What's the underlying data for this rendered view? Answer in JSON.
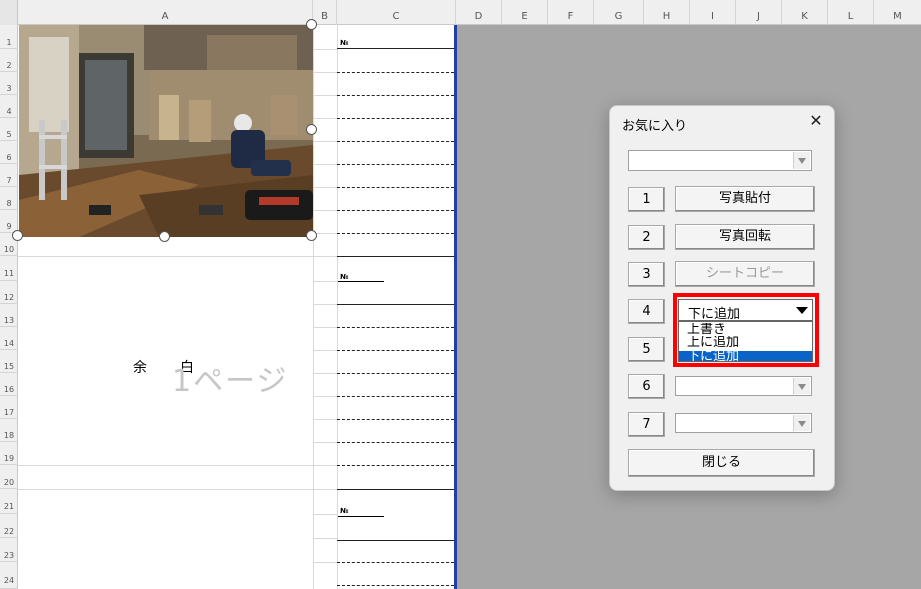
{
  "sheet": {
    "columns": [
      "A",
      "B",
      "C",
      "D",
      "E",
      "F",
      "G",
      "H",
      "I",
      "J",
      "K",
      "L",
      "M"
    ],
    "rows": [
      "1",
      "2",
      "3",
      "4",
      "5",
      "6",
      "7",
      "8",
      "9",
      "10",
      "11",
      "12",
      "13",
      "14",
      "15",
      "16",
      "17",
      "18",
      "19",
      "20",
      "21",
      "22",
      "23",
      "24"
    ],
    "no_label": "№",
    "margin_label_1": "余",
    "margin_label_2": "白",
    "page_watermark": "1ページ"
  },
  "dialog": {
    "title": "お気に入り",
    "close_glyph": "✕",
    "top_combo_value": "",
    "buttons": [
      {
        "num": "1",
        "label": "写真貼付",
        "enabled": true
      },
      {
        "num": "2",
        "label": "写真回転",
        "enabled": true
      },
      {
        "num": "3",
        "label": "シートコピー",
        "enabled": false
      },
      {
        "num": "4",
        "label": "",
        "enabled": true
      },
      {
        "num": "5",
        "label": "",
        "enabled": true
      },
      {
        "num": "6",
        "label": "",
        "enabled": true
      },
      {
        "num": "7",
        "label": "",
        "enabled": true
      }
    ],
    "dropdown": {
      "value": "下に追加",
      "options": [
        "上書き",
        "上に追加",
        "下に追加"
      ],
      "selected_index": 2
    },
    "close_button": "閉じる"
  },
  "colors": {
    "page_border": "#1f3fa6",
    "highlight_frame": "#ff0000",
    "selection": "#0a64c8"
  },
  "icons": [
    "close-icon",
    "chevron-down-icon",
    "selection-handle-icon"
  ]
}
